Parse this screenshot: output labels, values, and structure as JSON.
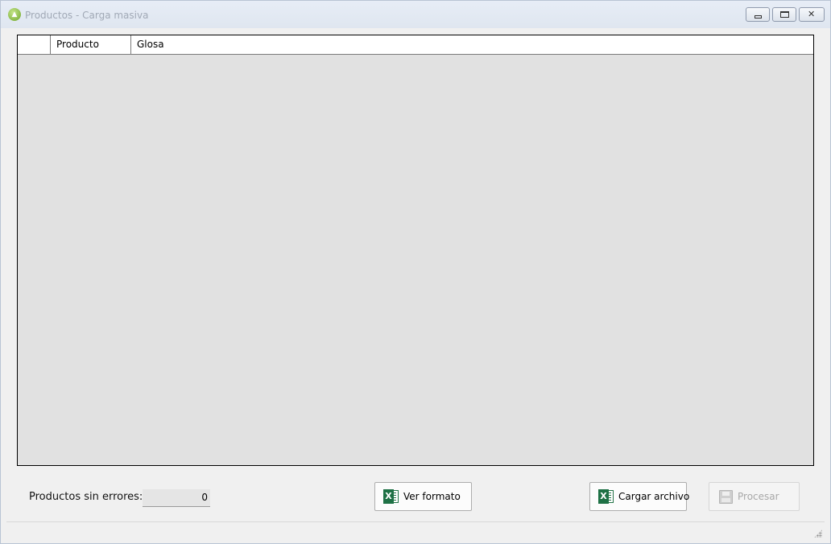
{
  "window": {
    "title": "Productos - Carga masiva",
    "icon": "shopping-bag-icon",
    "controls": [
      "minimize",
      "maximize",
      "close"
    ]
  },
  "grid": {
    "columns": [
      "",
      "Producto",
      "Glosa"
    ],
    "rows": []
  },
  "summary": {
    "label": "Productos sin errores:",
    "value": "0"
  },
  "buttons": {
    "ver_formato": {
      "label": "Ver formato",
      "icon": "excel-icon"
    },
    "cargar_archivo": {
      "label": "Cargar archivo",
      "icon": "excel-icon"
    },
    "procesar": {
      "label": "Procesar",
      "icon": "save-disk-icon",
      "enabled": false
    }
  },
  "colors": {
    "title_text": "#a1a9b6",
    "grid_background": "#e1e1e1",
    "excel_green": "#1e7145"
  }
}
